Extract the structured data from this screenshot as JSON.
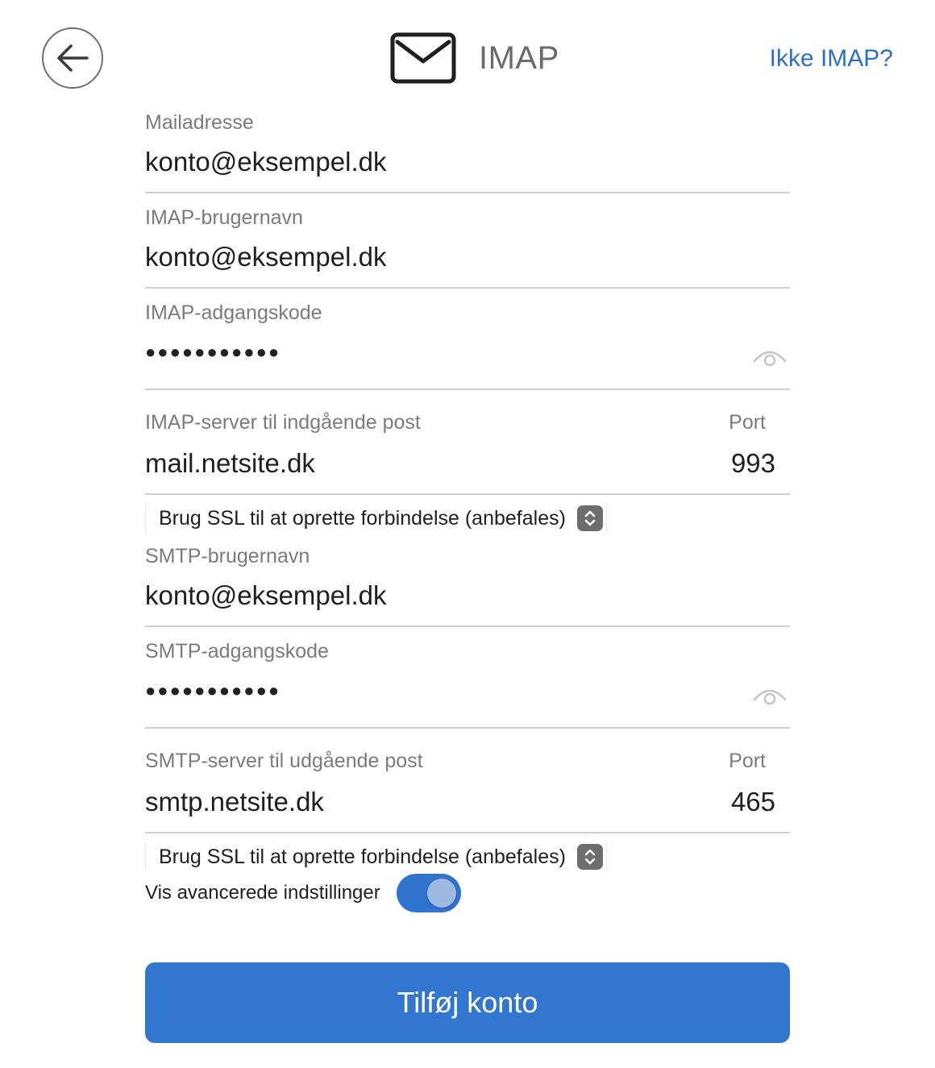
{
  "header": {
    "title": "IMAP",
    "not_imap_link": "Ikke IMAP?",
    "back_icon": "arrow-left-icon",
    "mail_icon": "envelope-icon"
  },
  "fields": {
    "email": {
      "label": "Mailadresse",
      "value": "konto@eksempel.dk"
    },
    "imap_username": {
      "label": "IMAP-brugernavn",
      "value": "konto@eksempel.dk"
    },
    "imap_password": {
      "label": "IMAP-adgangskode",
      "value": "●●●●●●●●●●●"
    },
    "imap_server": {
      "label": "IMAP-server til indgående post",
      "value": "mail.netsite.dk",
      "port_label": "Port",
      "port_value": "993"
    },
    "imap_ssl": {
      "value": "Brug SSL til at oprette forbindelse (anbefales)"
    },
    "smtp_username": {
      "label": "SMTP-brugernavn",
      "value": "konto@eksempel.dk"
    },
    "smtp_password": {
      "label": "SMTP-adgangskode",
      "value": "●●●●●●●●●●●"
    },
    "smtp_server": {
      "label": "SMTP-server til udgående post",
      "value": "smtp.netsite.dk",
      "port_label": "Port",
      "port_value": "465"
    },
    "smtp_ssl": {
      "value": "Brug SSL til at oprette forbindelse (anbefales)"
    }
  },
  "advanced": {
    "label": "Vis avancerede indstillinger",
    "enabled": true
  },
  "submit": {
    "label": "Tilføj konto"
  },
  "colors": {
    "accent": "#3176cf",
    "link": "#2a6fc9"
  }
}
